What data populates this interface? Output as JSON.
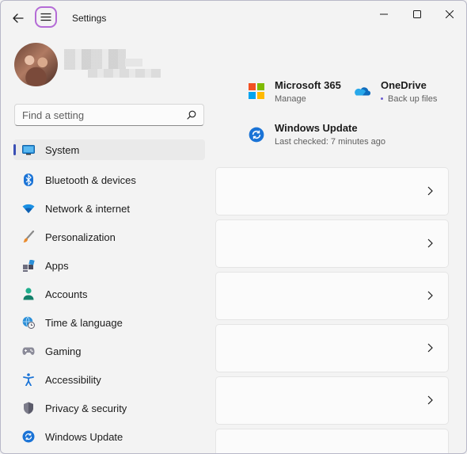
{
  "window": {
    "title": "Settings",
    "controls": [
      "minimize",
      "maximize",
      "close"
    ]
  },
  "search": {
    "placeholder": "Find a setting"
  },
  "nav": {
    "items": [
      {
        "label": "System",
        "icon": "monitor-icon",
        "selected": true
      },
      {
        "label": "Bluetooth & devices",
        "icon": "bluetooth-icon"
      },
      {
        "label": "Network & internet",
        "icon": "wifi-icon"
      },
      {
        "label": "Personalization",
        "icon": "brush-icon"
      },
      {
        "label": "Apps",
        "icon": "apps-icon"
      },
      {
        "label": "Accounts",
        "icon": "person-icon"
      },
      {
        "label": "Time & language",
        "icon": "globe-clock-icon"
      },
      {
        "label": "Gaming",
        "icon": "gamepad-icon"
      },
      {
        "label": "Accessibility",
        "icon": "accessibility-icon"
      },
      {
        "label": "Privacy & security",
        "icon": "shield-icon"
      },
      {
        "label": "Windows Update",
        "icon": "update-icon"
      }
    ]
  },
  "header_tiles": {
    "m365": {
      "title": "Microsoft 365",
      "subtitle": "Manage"
    },
    "onedrive": {
      "title": "OneDrive",
      "subtitle": "Back up files"
    },
    "update": {
      "title": "Windows Update",
      "subtitle": "Last checked: 7 minutes ago"
    }
  },
  "colors": {
    "accent": "#3a4fb5",
    "menu_highlight": "#b46bd6",
    "onedrive_blue": "#0f6cbd"
  }
}
